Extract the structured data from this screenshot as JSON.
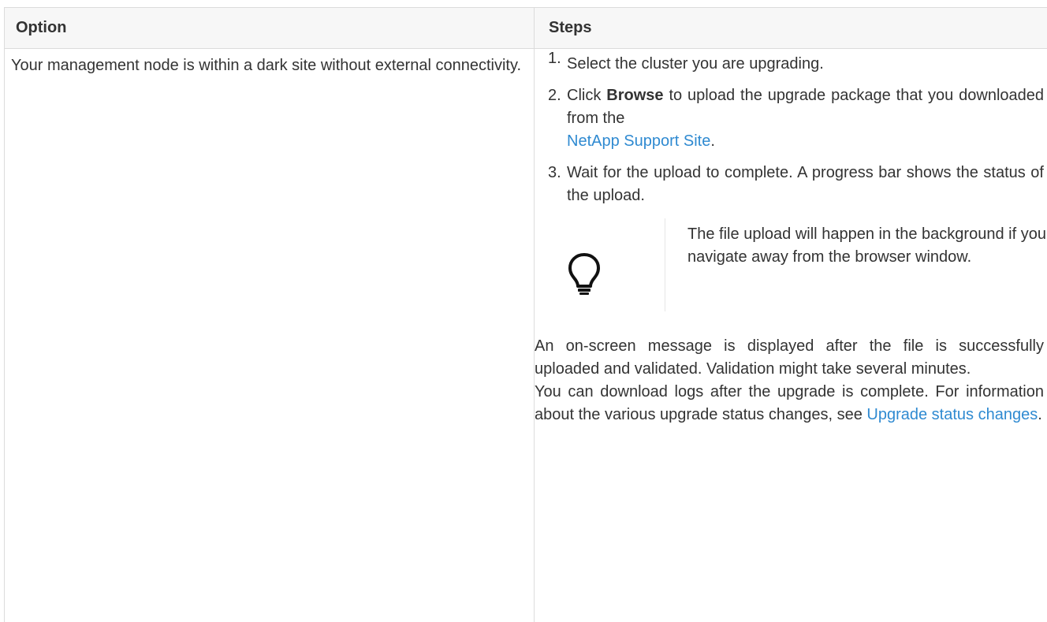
{
  "table": {
    "header": {
      "option": "Option",
      "steps": "Steps"
    },
    "row": {
      "option_text": "Your management node is within a dark site without external connectivity.",
      "steps": [
        {
          "number": "1.",
          "text": "Select the cluster you are upgrading."
        },
        {
          "number": "2.",
          "prefix": "Click ",
          "bold": "Browse",
          "middle": " to upload the upgrade package that you downloaded from the ",
          "link": "NetApp Support Site",
          "suffix": "."
        },
        {
          "number": "3.",
          "text": "Wait for the upload to complete. A progress bar shows the status of the upload."
        }
      ],
      "tip": {
        "icon": "lightbulb-icon",
        "text": "The file upload will happen in the background if you navigate away from the browser window."
      },
      "after_paragraph_1": "An on-screen message is displayed after the file is successfully uploaded and validated. Validation might take several minutes.",
      "after_paragraph_2_prefix": "You can download logs after the upgrade is complete. For information about the various upgrade status changes, see ",
      "after_paragraph_2_link": "Upgrade status changes",
      "after_paragraph_2_suffix": "."
    }
  },
  "colors": {
    "link": "#2f8ad1",
    "text": "#333333",
    "header_bg": "#f7f7f7",
    "border": "#dcdcdc"
  }
}
